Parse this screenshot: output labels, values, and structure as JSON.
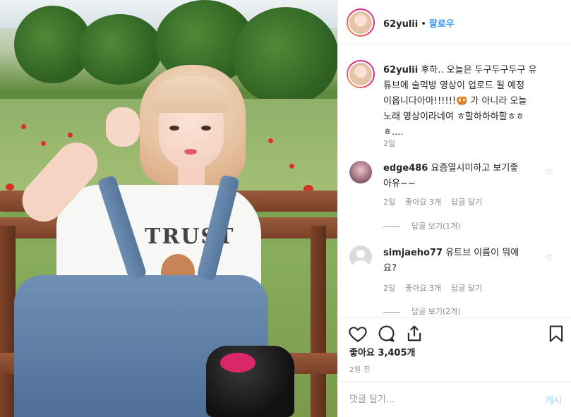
{
  "post": {
    "username": "62yulii",
    "follow_label": "팔로우",
    "separator": "•"
  },
  "caption": {
    "username": "62yulii",
    "lines": [
      "후하.. 오늘은 두구두구두구 유",
      "튜브에 술먹방 영상이 업로드 될 예정",
      "이옵니다아아!!!!!!🥨 가 아니라 오늘",
      "노래 영상이라네여 ㅎ할하하하할ㅎㅎ",
      "ㅎ...."
    ],
    "age": "2일"
  },
  "comments": [
    {
      "username": "edge486",
      "text_lines": [
        "요즘열시미하고 보기좋",
        "아유~~"
      ],
      "age": "2일",
      "likes": "좋아요 3개",
      "reply": "답글 달기",
      "view_replies": "답글 보기(1개)"
    },
    {
      "username": "simjaeho77",
      "text_lines": [
        "유트브 이름이 뭐에",
        "요?"
      ],
      "age": "2일",
      "likes": "좋아요 3개",
      "reply": "답글 달기",
      "view_replies": "답글 보기(2개)"
    }
  ],
  "icons": {
    "like": "heart-icon",
    "comment": "comment-bubble-icon",
    "share": "share-icon",
    "save": "bookmark-icon"
  },
  "stats": {
    "likes_label": "좋아요 3,405개",
    "posted": "2일 전"
  },
  "add_comment": {
    "placeholder": "댓글 달기...",
    "post_label": "게시"
  },
  "photo": {
    "shirt_print": "TRUST"
  }
}
